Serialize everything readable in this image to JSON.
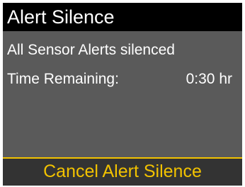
{
  "screen": {
    "title": "Alert Silence",
    "message": "All Sensor Alerts silenced",
    "time_remaining_label": "Time Remaining:",
    "time_remaining_value": "0:30 hr"
  },
  "actions": {
    "cancel_label": "Cancel Alert Silence"
  },
  "colors": {
    "title_bg": "#000000",
    "content_bg": "#5a5a5a",
    "text": "#ffffff",
    "accent": "#f2c200",
    "action_bg": "#333333"
  }
}
